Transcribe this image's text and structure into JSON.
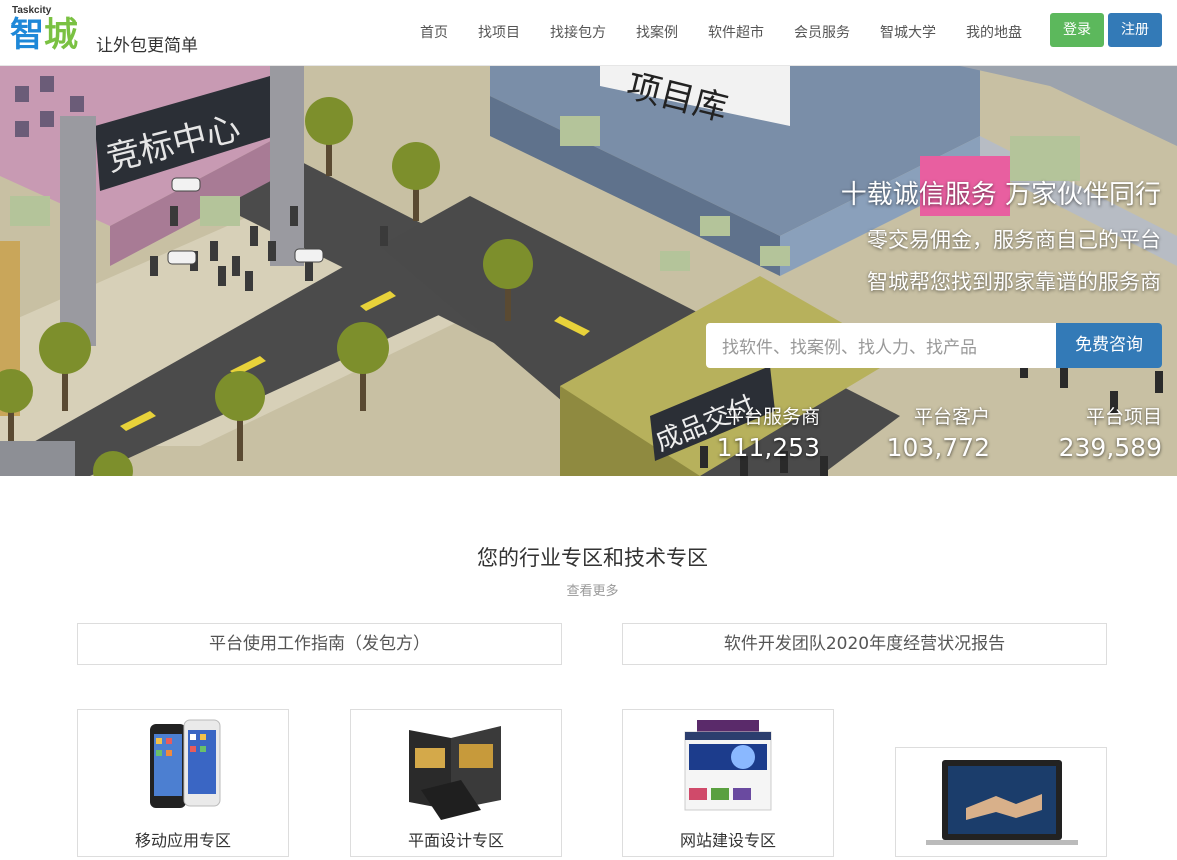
{
  "logo": {
    "en": "Taskcity",
    "cn_1": "智",
    "cn_2": "城",
    "slogan": "让外包更简单"
  },
  "nav": [
    "首页",
    "找项目",
    "找接包方",
    "找案例",
    "软件超市",
    "会员服务",
    "智城大学",
    "我的地盘"
  ],
  "auth": {
    "login": "登录",
    "register": "注册"
  },
  "hero": {
    "headline": "十载诚信服务 万家伙伴同行",
    "line2": "零交易佣金，服务商自己的平台",
    "line3": "智城帮您找到那家靠谱的服务商",
    "search_placeholder": "找软件、找案例、找人力、找产品",
    "search_button": "免费咨询",
    "signs": {
      "bidding": "竞标中心",
      "projects": "项目库",
      "delivery": "成品交付"
    },
    "stats": [
      {
        "label": "平台服务商",
        "value": "111,253"
      },
      {
        "label": "平台客户",
        "value": "103,772"
      },
      {
        "label": "平台项目",
        "value": "239,589"
      }
    ]
  },
  "section": {
    "title": "您的行业专区和技术专区",
    "more": "查看更多",
    "guides": [
      "平台使用工作指南（发包方）",
      "软件开发团队2020年度经营状况报告"
    ],
    "cards": [
      "移动应用专区",
      "平面设计专区",
      "网站建设专区",
      ""
    ]
  }
}
